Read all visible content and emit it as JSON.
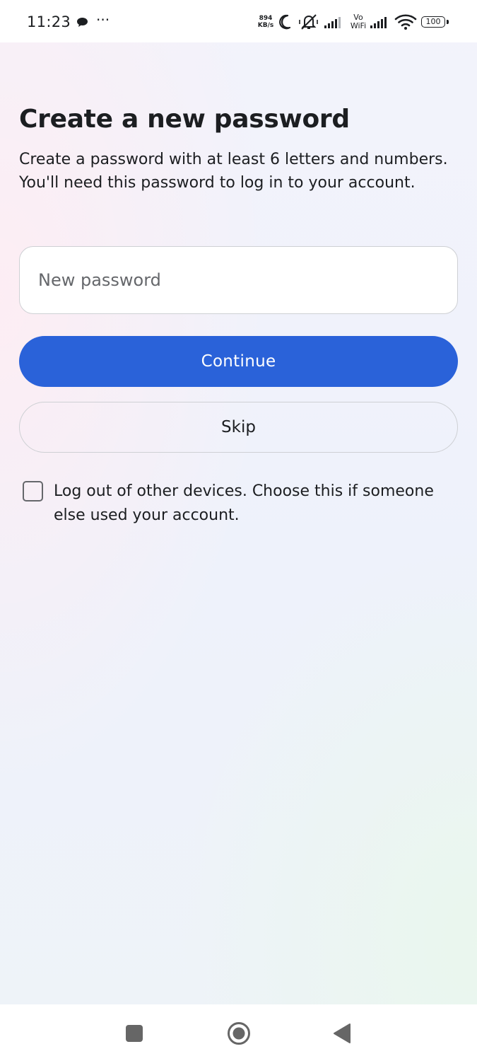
{
  "status_bar": {
    "time": "11:23",
    "network_speed_value": "894",
    "network_speed_unit": "KB/s",
    "vowifi_top": "Vo",
    "vowifi_bottom": "WiFi",
    "battery_level": "100",
    "icons": [
      "chat-bubble-icon",
      "more-dots-icon",
      "moon-icon",
      "vibrate-off-icon",
      "signal-icon",
      "wifi-icon",
      "battery-icon"
    ]
  },
  "page": {
    "title": "Create a new password",
    "description": "Create a password with at least 6 letters and numbers. You'll need this password to log in to your account."
  },
  "form": {
    "password_placeholder": "New password",
    "password_value": "",
    "continue_label": "Continue",
    "skip_label": "Skip",
    "logout_checked": false,
    "logout_label": "Log out of other devices. Choose this if someone else used your account."
  },
  "nav_bar": {
    "icons": [
      "recents-square-icon",
      "home-circle-icon",
      "back-triangle-icon"
    ]
  },
  "colors": {
    "primary_button": "#2a62d9",
    "text": "#1c1e21",
    "secondary_text": "#65676b",
    "border": "#ced0d4"
  }
}
